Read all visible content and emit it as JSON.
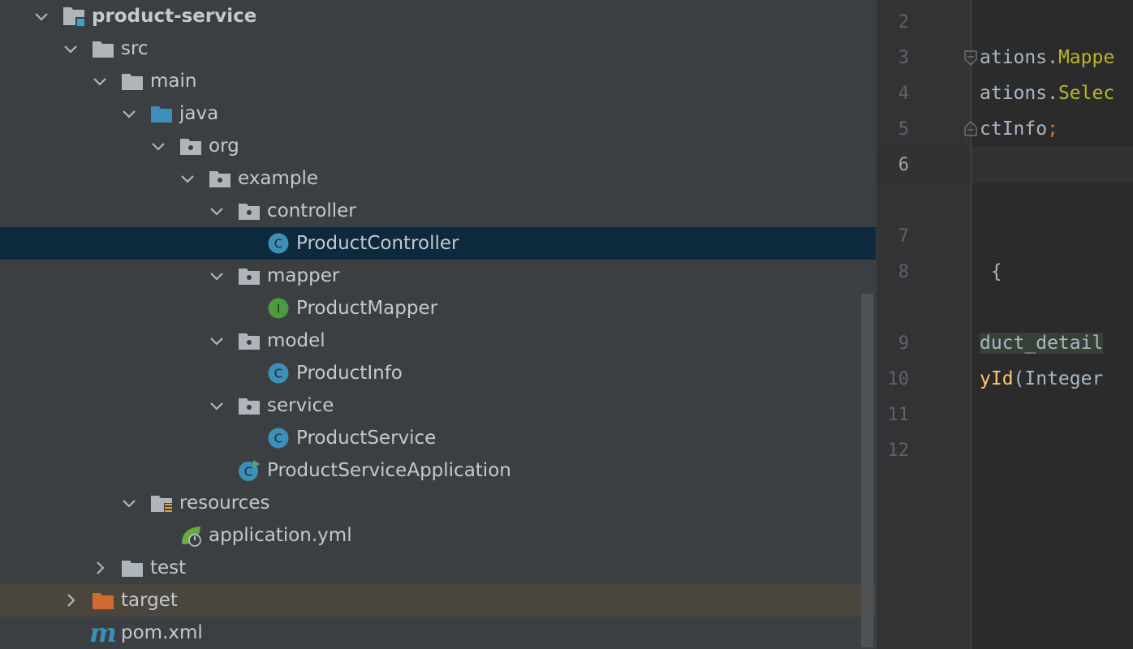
{
  "project_tree": {
    "items": [
      {
        "label": "product-service",
        "bold": true
      },
      {
        "label": "src"
      },
      {
        "label": "main"
      },
      {
        "label": "java"
      },
      {
        "label": "org"
      },
      {
        "label": "example"
      },
      {
        "label": "controller"
      },
      {
        "label": "ProductController",
        "selected": true
      },
      {
        "label": "mapper"
      },
      {
        "label": "ProductMapper"
      },
      {
        "label": "model"
      },
      {
        "label": "ProductInfo"
      },
      {
        "label": "service"
      },
      {
        "label": "ProductService"
      },
      {
        "label": "ProductServiceApplication"
      },
      {
        "label": "resources"
      },
      {
        "label": "application.yml"
      },
      {
        "label": "test"
      },
      {
        "label": "target"
      },
      {
        "label": "pom.xml"
      }
    ],
    "icons": {
      "class": "C",
      "interface": "I",
      "maven": "m"
    }
  },
  "editor": {
    "line_numbers": [
      "2",
      "3",
      "4",
      "5",
      "6",
      "7",
      "8",
      "9",
      "10",
      "11",
      "12"
    ],
    "current_line": "6",
    "code": {
      "l3_a": "ations.",
      "l3_b": "Mappe",
      "l4_a": "ations.",
      "l4_b": "Selec",
      "l5_a": "ctInfo",
      "l5_b": ";",
      "l8": " {",
      "l9": "duct_detail",
      "l10_a": "yId",
      "l10_b": "(Integer"
    }
  },
  "colors": {
    "tree_bg": "#3c3f41",
    "selection": "#0d293e",
    "excluded": "#4a463d",
    "folder": "#aeb5bb",
    "source_folder": "#3c8fb6",
    "target_folder": "#d26b30",
    "class_icon": "#3c8fb6",
    "interface_icon": "#4e9a3e",
    "editor_bg": "#2b2b2b"
  }
}
